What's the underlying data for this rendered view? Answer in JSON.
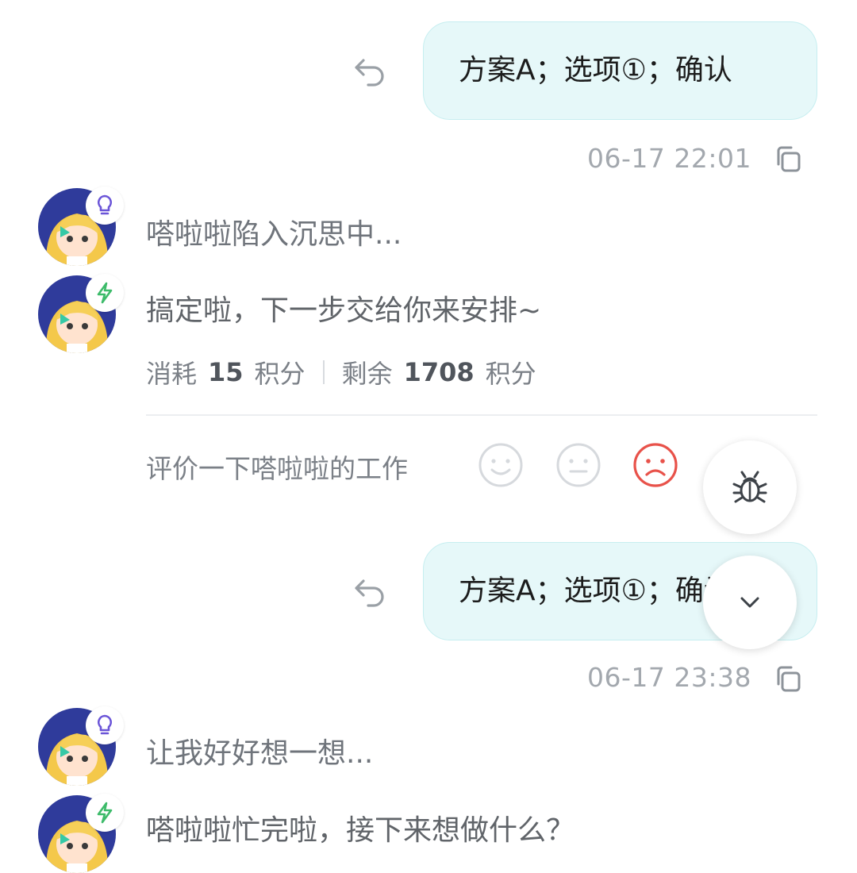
{
  "messages": [
    {
      "user_text": "方案A；选项①；确认",
      "timestamp": "06-17 22:01"
    },
    {
      "user_text": "方案A；选项①；确认",
      "timestamp": "06-17 23:38"
    }
  ],
  "bot": {
    "thinking_1": "嗒啦啦陷入沉思中...",
    "reply_1": "搞定啦，下一步交给你来安排~",
    "stats": {
      "consumed_label": "消耗",
      "consumed_value": "15",
      "consumed_unit": "积分",
      "remaining_label": "剩余",
      "remaining_value": "1708",
      "remaining_unit": "积分"
    },
    "rate_prompt": "评价一下嗒啦啦的工作",
    "thinking_2": "让我好好想一想...",
    "reply_2": "嗒啦啦忙完啦，接下来想做什么？"
  },
  "icons": {
    "reply": "reply-icon",
    "copy": "copy-icon",
    "thinking_badge": "lightbulb-icon",
    "done_badge": "lightning-icon",
    "rating": [
      "smile-icon",
      "neutral-icon",
      "frown-icon"
    ],
    "debug": "bug-icon",
    "scroll_down": "chevron-down-icon"
  },
  "colors": {
    "bubble_bg": "#e6f8f9",
    "frown_active": "#e8524a",
    "lightbulb": "#6b55d8",
    "lightning": "#3dbb6a"
  }
}
